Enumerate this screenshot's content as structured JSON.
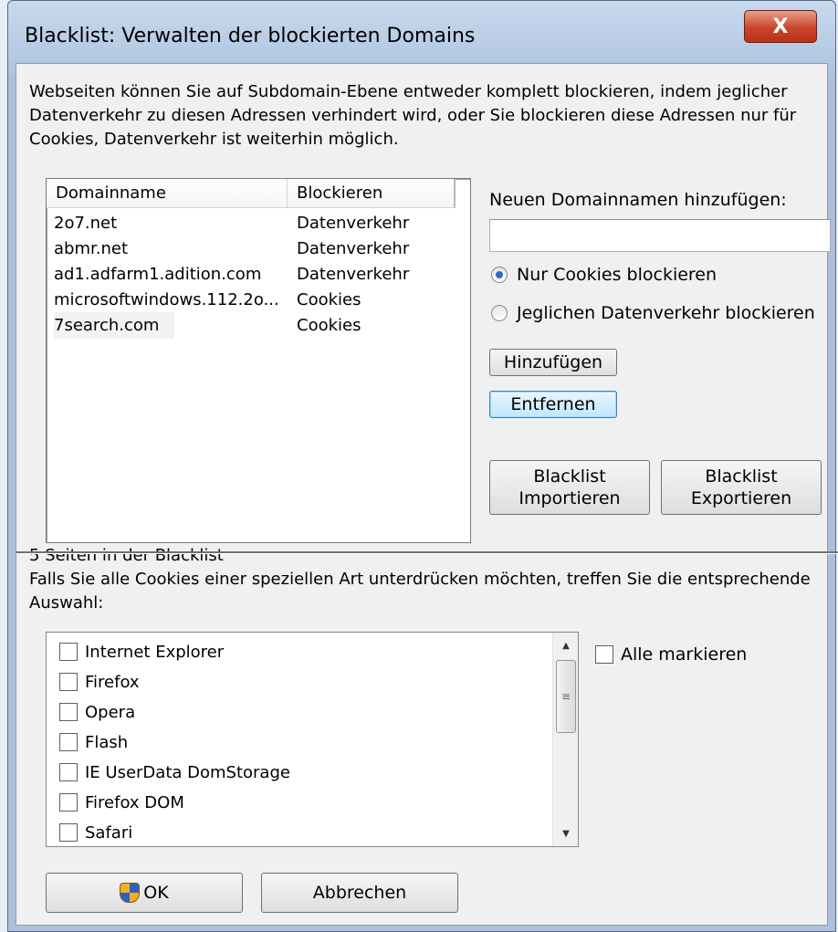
{
  "window": {
    "title": "Blacklist: Verwalten der blockierten Domains",
    "close_label": "X"
  },
  "intro_text": "Webseiten können Sie auf Subdomain-Ebene entweder komplett blockieren, indem jeglicher Datenverkehr zu diesen Adressen verhindert wird, oder Sie blockieren diese Adressen nur für Cookies, Datenverkehr ist weiterhin möglich.",
  "domain_list": {
    "columns": [
      "Domainname",
      "Blockieren"
    ],
    "rows": [
      [
        "2o7.net",
        "Datenverkehr"
      ],
      [
        "abmr.net",
        "Datenverkehr"
      ],
      [
        "ad1.adfarm1.adition.com",
        "Datenverkehr"
      ],
      [
        "microsoftwindows.112.2o...",
        "Cookies"
      ],
      [
        "7search.com",
        "Cookies"
      ]
    ],
    "status": "5 Seiten in der Blacklist"
  },
  "add_domain": {
    "label": "Neuen Domainnamen hinzufügen:",
    "value": "",
    "radio_cookies": "Nur Cookies blockieren",
    "radio_traffic": "Jeglichen Datenverkehr blockieren",
    "selected": "cookies"
  },
  "buttons": {
    "add": "Hinzufügen",
    "remove": "Entfernen",
    "import_line1": "Blacklist",
    "import_line2": "Importieren",
    "export_line1": "Blacklist",
    "export_line2": "Exportieren",
    "ok": "OK",
    "cancel": "Abbrechen"
  },
  "cookie_section": {
    "text": "Falls Sie alle Cookies einer speziellen Art unterdrücken möchten, treffen Sie die entsprechende Auswahl:",
    "items": [
      "Internet Explorer",
      "Firefox",
      "Opera",
      "Flash",
      "IE UserData DomStorage",
      "Firefox DOM",
      "Safari"
    ],
    "select_all": "Alle markieren"
  }
}
